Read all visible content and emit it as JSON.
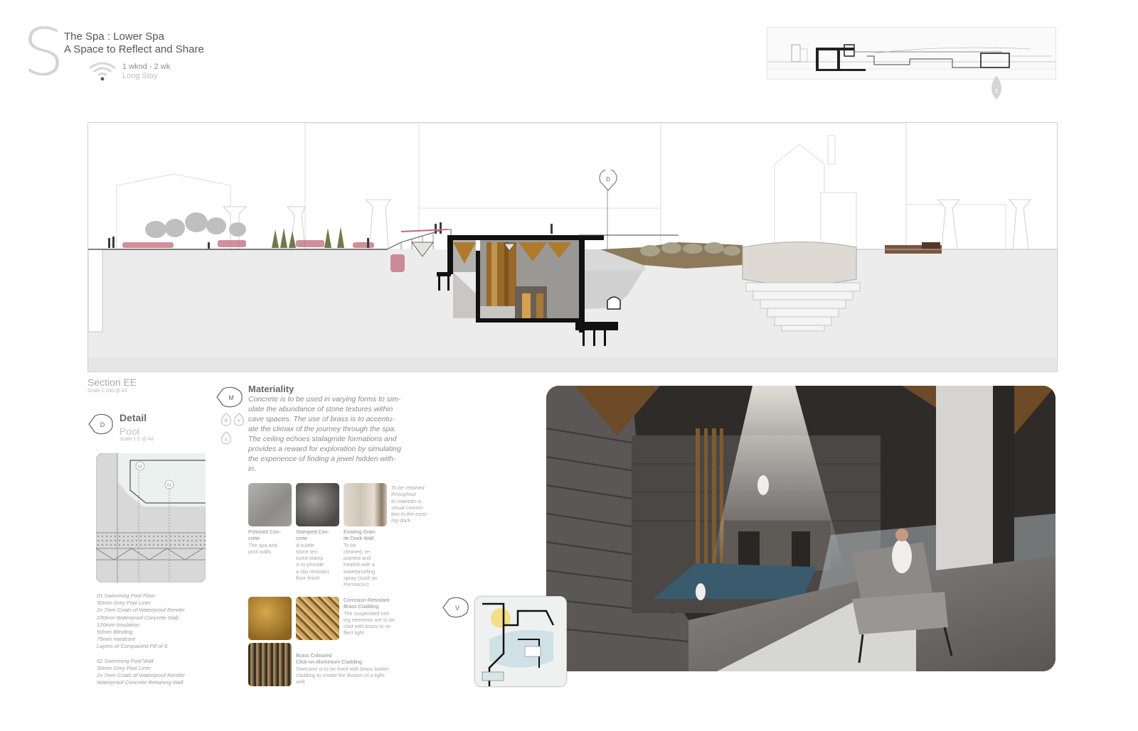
{
  "header": {
    "letter": "S",
    "title_line1": "The Spa : Lower Spa",
    "title_line2": "A Space to Reflect and Share",
    "duration": "1 wknd - 2 wk",
    "stay_type": "Long Stay",
    "icon": "wifi-icon"
  },
  "keyplan": {
    "marker_label": "S"
  },
  "section": {
    "title": "Section EE",
    "scale": "Scale 1:100 @ A1",
    "detail_callout": "D"
  },
  "detail": {
    "marker": "D",
    "title": "Detail",
    "subtitle": "Pool",
    "scale": "Scale 1:5 @ A0",
    "tags": [
      "02",
      "01"
    ],
    "notes": [
      "01 Swimming Pool Floor",
      "30mm Grey Pool Liner",
      "2x 7mm Coats of Waterproof Render",
      "230mm Waterproof Concrete Slab",
      "120mm Insulation",
      "50mm Blinding",
      "75mm Hardcore",
      "Layers of Compacted Fill of S",
      "",
      "02 Swimming Pool Wall",
      "30mm Grey Pool Liner",
      "2x 7mm Coats of Waterproof Render",
      "Waterproof Concrete Retaining Wall"
    ]
  },
  "materiality": {
    "marker": "M",
    "sub_markers": [
      "B",
      "V",
      "S"
    ],
    "title": "Materiality",
    "text_lines": [
      "Concrete is to be used in varying forms to sim-",
      "ulate the abundance of stone textures within",
      "cave spaces. The use of brass is to accentu-",
      "ate the climax of the journey through the spa.",
      "The ceiling echoes stalagmite formations and",
      "provides a reward for exploration by simulating",
      "the experience of finding a jewel hidden with-",
      "in."
    ],
    "note_right": [
      "To be retained",
      "throughout",
      "to maintain a",
      "visual connec-",
      "tion to the exist-",
      "ing dock."
    ],
    "materials": [
      {
        "name": [
          "Polished Con-",
          "crete"
        ],
        "desc": [
          "The spa and",
          "pool walls"
        ],
        "color": "#9a9996"
      },
      {
        "name": [
          "Stamped Con-",
          "crete"
        ],
        "desc": [
          "A subtle",
          "stone tex-",
          "tured stamp",
          "is to provide",
          "a slip resistant",
          "floor finish"
        ],
        "color": "#6e6c6a"
      },
      {
        "name": [
          "Existing Gran-",
          "ite Dock Wall"
        ],
        "desc": [
          "To be",
          "cleaned, re-",
          "pointed and",
          "treated with a",
          "waterproofing",
          "spray (such as",
          "Permacon)"
        ],
        "color": "#d8cfc6"
      },
      {
        "name": [
          "Corrosion-Resistant",
          "Brass Cladding"
        ],
        "desc": [
          "The suspended ceil-",
          "ing elements are to be",
          "clad with brass to re-",
          "flect light"
        ],
        "color": "#a07a2a"
      },
      {
        "name": [
          "Brass Coloured",
          "Click-on Aluminium Cladding"
        ],
        "desc": [
          "Staircase is to be lined with brass batten",
          "cladding to create the illusion of a light-",
          "well"
        ],
        "color": "#6b5a3e"
      }
    ],
    "brass_second_color": "#b8935a"
  },
  "view": {
    "marker": "V"
  },
  "colors": {
    "accent_brass": "#b07a2c",
    "section_bg": "#f7f7f7",
    "ground": "#ebebeb",
    "render_dark": "#3a3633"
  }
}
